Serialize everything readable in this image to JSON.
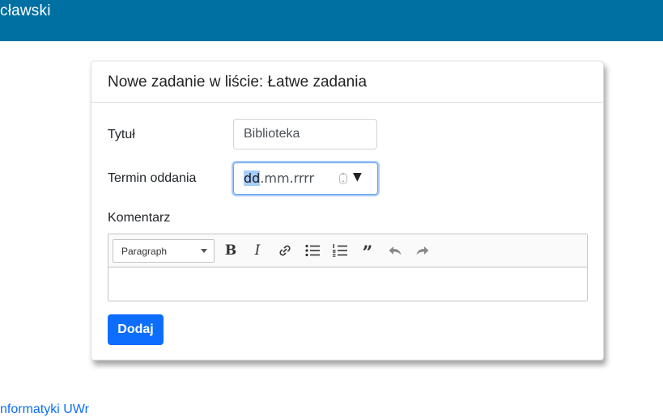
{
  "navbar": {
    "brand_text": "cławski",
    "bg_color": "#0070a3"
  },
  "card": {
    "title": "Nowe zadanie w liście: Łatwe zadania",
    "fields": {
      "title_label": "Tytuł",
      "title_value": "Biblioteka",
      "due_label": "Termin oddania",
      "due_segment_selected": "dd",
      "due_segment_rest": ".mm.rrrr",
      "comment_label": "Komentarz"
    },
    "editor": {
      "paragraph_select": "Paragraph",
      "toolbar_icons": [
        "bold-icon",
        "italic-icon",
        "link-icon",
        "bulleted-list-icon",
        "numbered-list-icon",
        "block-quote-icon",
        "undo-icon",
        "redo-icon"
      ],
      "content": ""
    },
    "submit_label": "Dodaj",
    "accent_color": "#0d6efd"
  },
  "footer": {
    "link_text": "nformatyki UWr"
  }
}
